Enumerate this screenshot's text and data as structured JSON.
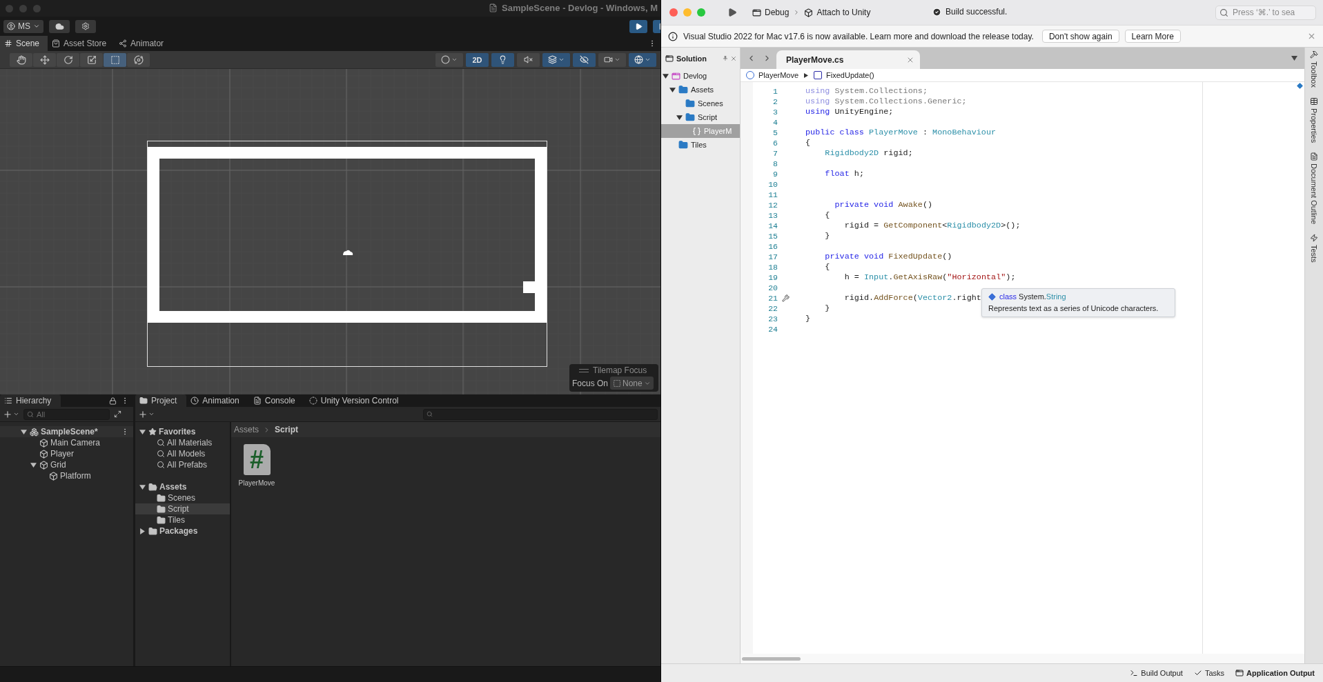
{
  "unity": {
    "title": "SampleScene - Devlog - Windows, M",
    "account": "MS",
    "tabs": [
      {
        "label": "Scene",
        "kind": "scene",
        "selected": true
      },
      {
        "label": "Asset Store",
        "kind": "store",
        "selected": false
      },
      {
        "label": "Animator",
        "kind": "animator",
        "selected": false
      }
    ],
    "tools": [
      {
        "kind": "hand",
        "selected": false
      },
      {
        "kind": "move",
        "selected": false
      },
      {
        "kind": "rotate",
        "selected": false
      },
      {
        "kind": "scale",
        "selected": false
      },
      {
        "kind": "rect",
        "selected": true
      },
      {
        "kind": "transform",
        "selected": false
      }
    ],
    "view_options": [
      {
        "kind": "shading",
        "menu": true,
        "selected": false
      },
      {
        "kind": "dimension",
        "label": "2D",
        "menu": false,
        "selected": true
      },
      {
        "kind": "lighting",
        "menu": false,
        "selected": true
      },
      {
        "kind": "audio",
        "menu": false,
        "selected": false
      },
      {
        "kind": "effects",
        "menu": true,
        "selected": true
      },
      {
        "kind": "visibility",
        "menu": false,
        "selected": true
      },
      {
        "kind": "camera",
        "menu": true,
        "selected": false
      },
      {
        "kind": "gizmos",
        "menu": true,
        "selected": true
      }
    ],
    "tilemap_focus": {
      "title": "Tilemap Focus",
      "label": "Focus On",
      "value": "None"
    },
    "hierarchy": {
      "title": "Hierarchy",
      "search_placeholder": "All",
      "items": [
        {
          "label": "SampleScene*",
          "kind": "scene",
          "expanded": true,
          "children": [
            {
              "label": "Main Camera",
              "kind": "object"
            },
            {
              "label": "Player",
              "kind": "object"
            },
            {
              "label": "Grid",
              "kind": "object",
              "expanded": true,
              "children": [
                {
                  "label": "Platform",
                  "kind": "object"
                }
              ]
            }
          ]
        }
      ]
    },
    "project": {
      "tabs": [
        {
          "label": "Project",
          "kind": "project",
          "selected": true
        },
        {
          "label": "Animation",
          "kind": "animation",
          "selected": false
        },
        {
          "label": "Console",
          "kind": "console",
          "selected": false
        },
        {
          "label": "Unity Version Control",
          "kind": "vcs",
          "selected": false
        }
      ],
      "tree": [
        {
          "label": "Favorites",
          "kind": "favorites",
          "expanded": true,
          "selected": false,
          "children": [
            {
              "label": "All Materials",
              "kind": "search",
              "selected": false
            },
            {
              "label": "All Models",
              "kind": "search",
              "selected": false
            },
            {
              "label": "All Prefabs",
              "kind": "search",
              "selected": false
            }
          ]
        },
        {
          "label": "Assets",
          "kind": "open_folder",
          "expanded": true,
          "selected": false,
          "children": [
            {
              "label": "Scenes",
              "kind": "folder",
              "selected": false
            },
            {
              "label": "Script",
              "kind": "folder",
              "selected": true
            },
            {
              "label": "Tiles",
              "kind": "folder",
              "selected": false
            }
          ]
        },
        {
          "label": "Packages",
          "kind": "folder",
          "expanded": false,
          "selected": false
        }
      ],
      "breadcrumb": [
        "Assets",
        "Script"
      ],
      "files": [
        {
          "label": "PlayerMove",
          "glyph": "#"
        }
      ]
    }
  },
  "vs": {
    "toolbar": {
      "config": "Debug",
      "target": "Attach to Unity",
      "status": "Build successful.",
      "search_placeholder": "Press ‘⌘.’ to sea"
    },
    "infobar": {
      "message": "Visual Studio 2022 for Mac v17.6 is now available. Learn more and download the release today.",
      "buttons": [
        "Don't show again",
        "Learn More"
      ]
    },
    "solution": {
      "title": "Solution",
      "items": [
        {
          "label": "Devlog",
          "kind": "solution",
          "expanded": true,
          "selected": false,
          "children": [
            {
              "label": "Assets",
              "kind": "folder",
              "expanded": true,
              "selected": false,
              "children": [
                {
                  "label": "Scenes",
                  "kind": "folder",
                  "selected": false
                },
                {
                  "label": "Script",
                  "kind": "folder",
                  "expanded": true,
                  "selected": false,
                  "children": [
                    {
                      "label": "PlayerM",
                      "kind": "file",
                      "selected": true
                    }
                  ]
                }
              ]
            },
            {
              "label": "Tiles",
              "kind": "folder",
              "selected": false
            }
          ]
        }
      ]
    },
    "editor": {
      "tabs": [
        {
          "label": "PlayerMove.cs",
          "selected": true
        }
      ],
      "breadcrumb": [
        {
          "label": "PlayerMove",
          "kind": "class"
        },
        {
          "label": "FixedUpdate()",
          "kind": "method"
        }
      ],
      "lines": [
        {
          "number": "1",
          "tokens": [
            {
              "kind": "keyword_dim",
              "text": "using"
            },
            {
              "kind": "dim",
              "text": " System.Collections;"
            }
          ]
        },
        {
          "number": "2",
          "tokens": [
            {
              "kind": "keyword_dim",
              "text": "using"
            },
            {
              "kind": "dim",
              "text": " System.Collections.Generic;"
            }
          ]
        },
        {
          "number": "3",
          "tokens": [
            {
              "kind": "keyword",
              "text": "using"
            },
            {
              "kind": "plain",
              "text": " UnityEngine;"
            }
          ]
        },
        {
          "number": "4"
        },
        {
          "number": "5",
          "tokens": [
            {
              "kind": "keyword",
              "text": "public class "
            },
            {
              "kind": "type",
              "text": "PlayerMove"
            },
            {
              "kind": "plain",
              "text": " : "
            },
            {
              "kind": "type",
              "text": "MonoBehaviour"
            }
          ]
        },
        {
          "number": "6",
          "tokens": [
            {
              "kind": "plain",
              "text": "{"
            }
          ]
        },
        {
          "number": "7",
          "tokens": [
            {
              "kind": "type",
              "text": "    Rigidbody2D"
            },
            {
              "kind": "plain",
              "text": " rigid;"
            }
          ]
        },
        {
          "number": "8"
        },
        {
          "number": "9",
          "tokens": [
            {
              "kind": "keyword",
              "text": "    float"
            },
            {
              "kind": "plain",
              "text": " h;"
            }
          ]
        },
        {
          "number": "10"
        },
        {
          "number": "11"
        },
        {
          "number": "12",
          "tokens": [
            {
              "kind": "keyword",
              "text": "      private void "
            },
            {
              "kind": "method",
              "text": "Awake"
            },
            {
              "kind": "plain",
              "text": "()"
            }
          ]
        },
        {
          "number": "13",
          "tokens": [
            {
              "kind": "plain",
              "text": "    {"
            }
          ]
        },
        {
          "number": "14",
          "tokens": [
            {
              "kind": "plain",
              "text": "        rigid = "
            },
            {
              "kind": "method",
              "text": "GetComponent"
            },
            {
              "kind": "plain",
              "text": "<"
            },
            {
              "kind": "type",
              "text": "Rigidbody2D"
            },
            {
              "kind": "plain",
              "text": ">();"
            }
          ]
        },
        {
          "number": "15",
          "tokens": [
            {
              "kind": "plain",
              "text": "    }"
            }
          ]
        },
        {
          "number": "16"
        },
        {
          "number": "17",
          "tokens": [
            {
              "kind": "keyword",
              "text": "    private void "
            },
            {
              "kind": "method",
              "text": "FixedUpdate"
            },
            {
              "kind": "plain",
              "text": "()"
            }
          ]
        },
        {
          "number": "18",
          "tokens": [
            {
              "kind": "plain",
              "text": "    {"
            }
          ]
        },
        {
          "number": "19",
          "tokens": [
            {
              "kind": "plain",
              "text": "        h = "
            },
            {
              "kind": "type",
              "text": "Input"
            },
            {
              "kind": "plain",
              "text": "."
            },
            {
              "kind": "method",
              "text": "GetAxisRaw"
            },
            {
              "kind": "plain",
              "text": "("
            },
            {
              "kind": "string",
              "text": "\"Horizontal\""
            },
            {
              "kind": "plain",
              "text": ");"
            }
          ]
        },
        {
          "number": "20"
        },
        {
          "number": "21",
          "quick_fix": true,
          "tokens": [
            {
              "kind": "plain",
              "text": "        rigid."
            },
            {
              "kind": "method",
              "text": "AddForce"
            },
            {
              "kind": "plain",
              "text": "("
            },
            {
              "kind": "type",
              "text": "Vector2"
            },
            {
              "kind": "plain",
              "text": ".right"
            }
          ]
        },
        {
          "number": "22",
          "tokens": [
            {
              "kind": "plain",
              "text": "    }"
            }
          ]
        },
        {
          "number": "23",
          "tokens": [
            {
              "kind": "plain",
              "text": "}"
            }
          ]
        },
        {
          "number": "24"
        }
      ],
      "tooltip": {
        "signature": [
          {
            "kind": "keyword",
            "text": "class"
          },
          {
            "kind": "plain",
            "text": " System."
          },
          {
            "kind": "type",
            "text": "String"
          }
        ],
        "description": "Represents text as a series of Unicode characters."
      }
    },
    "side_pads": [
      {
        "label": "Toolbox",
        "kind": "toolbox"
      },
      {
        "label": "Properties",
        "kind": "properties"
      },
      {
        "label": "Document Outline",
        "kind": "outline"
      },
      {
        "label": "Tests",
        "kind": "tests"
      }
    ],
    "status_bar": [
      {
        "label": "Build Output",
        "kind": "build"
      },
      {
        "label": "Tasks",
        "kind": "tasks"
      },
      {
        "label": "Application Output",
        "kind": "output"
      }
    ]
  }
}
